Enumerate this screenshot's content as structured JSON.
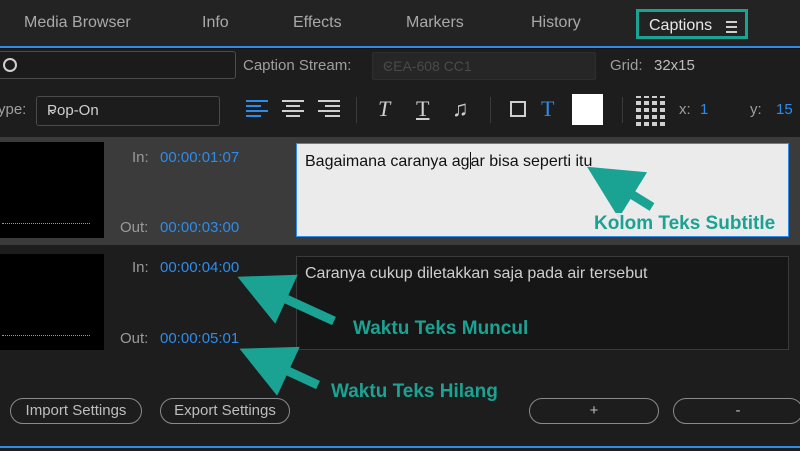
{
  "tabs": [
    {
      "label": "Media Browser"
    },
    {
      "label": "Info"
    },
    {
      "label": "Effects"
    },
    {
      "label": "Markers"
    },
    {
      "label": "History"
    },
    {
      "label": "Captions"
    }
  ],
  "toolbar": {
    "caption_stream_label": "Caption Stream:",
    "caption_stream_value": "CEA-608 CC1",
    "grid_label": "Grid:",
    "grid_value": "32x15",
    "type_label": "ype:",
    "type_value": "Pop-On",
    "x_label": "x:",
    "x_value": "1",
    "y_label": "y:",
    "y_value": "15",
    "bold_t": "T",
    "plain_t": "T",
    "color_t": "T",
    "music_note": "♫"
  },
  "captions": [
    {
      "in_label": "In:",
      "in": "00:00:01:07",
      "out_label": "Out:",
      "out": "00:00:03:00",
      "text_before": "Bagaimana caranya ag",
      "text_after": "ar bisa seperti itu"
    },
    {
      "in_label": "In:",
      "in": "00:00:04:00",
      "out_label": "Out:",
      "out": "00:00:05:01",
      "text": "Caranya cukup diletakkan saja pada air tersebut"
    }
  ],
  "annotations": {
    "subtitle_column": "Kolom Teks Subtitle",
    "appear_time": "Waktu Teks Muncul",
    "disappear_time": "Waktu Teks Hilang"
  },
  "buttons": {
    "import": "Import Settings",
    "export": "Export Settings",
    "add": "+",
    "remove": "-"
  },
  "colors": {
    "accent": "#2d8ceb",
    "annotation": "#1aa392"
  }
}
